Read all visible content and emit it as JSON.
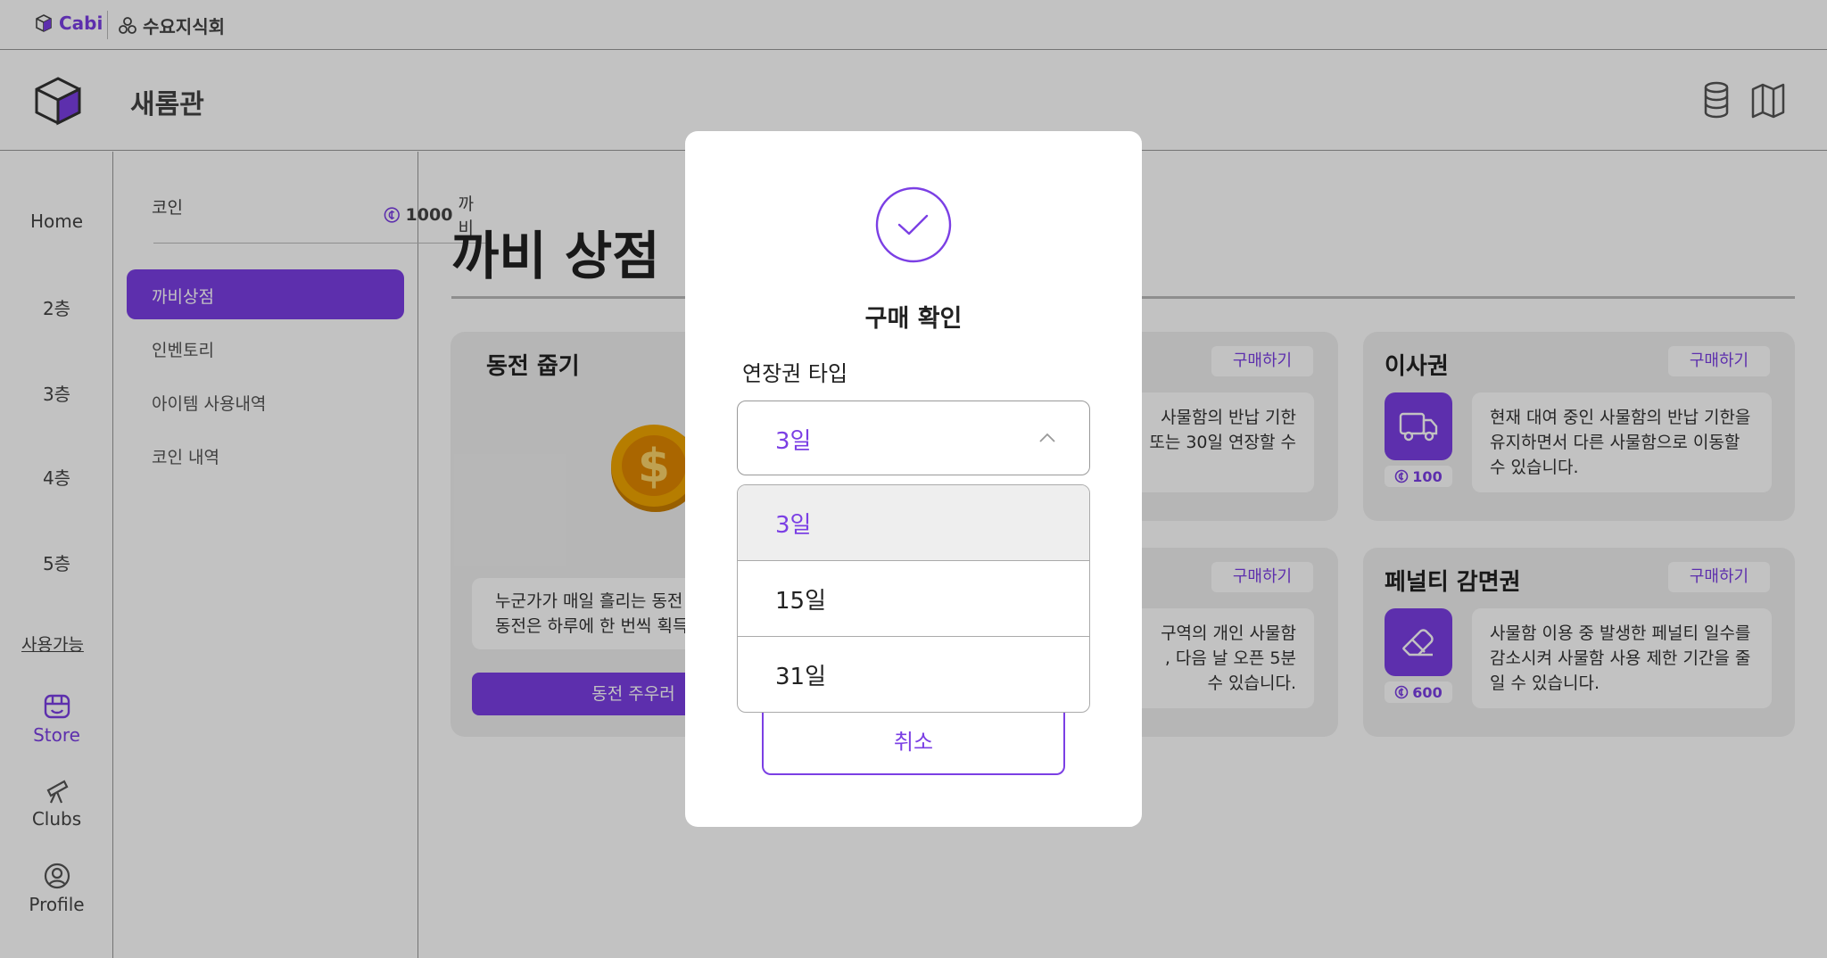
{
  "topbar": {
    "brand": "Cabi",
    "org": "수요지식회"
  },
  "header": {
    "building": "새롬관"
  },
  "nav": {
    "items": [
      "Home",
      "2층",
      "3층",
      "4층",
      "5층"
    ],
    "available_label": "사용가능",
    "bottom": [
      "Store",
      "Clubs",
      "Profile"
    ]
  },
  "submenu": {
    "coin_label": "코인",
    "coin_value": "1000",
    "coin_unit": "까비",
    "items": [
      "까비상점",
      "인벤토리",
      "아이템 사용내역",
      "코인 내역"
    ]
  },
  "store": {
    "title": "까비 상점",
    "buy_label": "구매하기",
    "coin_card": {
      "title": "동전 줍기",
      "desc_line1": "누군가가 매일 흘리는 동전",
      "desc_line2": "동전은 하루에 한 번씩 획득",
      "button": "동전 주우러"
    },
    "top_middle_desc": [
      "사물함의 반납 기한",
      "또는 30일 연장할 수"
    ],
    "bottom_middle_desc": [
      "구역의 개인 사물함",
      ", 다음 날 오픈 5분",
      "수 있습니다."
    ],
    "move_card": {
      "title": "이사권",
      "price": "100",
      "desc": "현재 대여 중인 사물함의 반납 기한을 유지하면서 다른 사물함으로 이동할 수 있습니다."
    },
    "penalty_card": {
      "title": "페널티 감면권",
      "price": "600",
      "desc": "사물함 이용 중 발생한 페널티 일수를 감소시켜 사물함 사용 제한 기간을 줄일 수 있습니다."
    }
  },
  "modal": {
    "title": "구매 확인",
    "field_label": "연장권 타입",
    "selected": "3일",
    "options": [
      "3일",
      "15일",
      "31일"
    ],
    "cancel": "취소"
  },
  "colors": {
    "accent": "#7b3fe4"
  }
}
